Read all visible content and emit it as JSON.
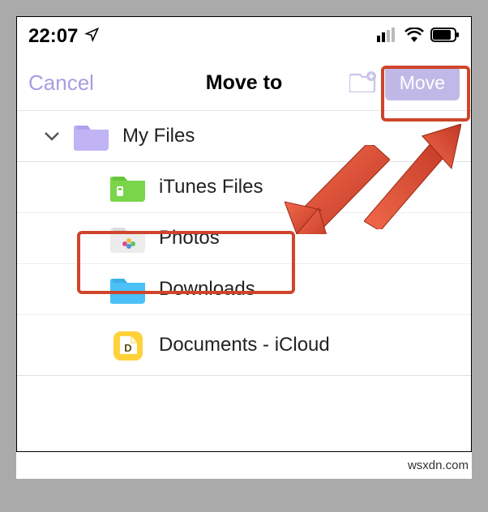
{
  "status": {
    "time": "22:07"
  },
  "nav": {
    "cancel_label": "Cancel",
    "title": "Move to",
    "move_label": "Move"
  },
  "folders": {
    "root": {
      "label": "My Files"
    },
    "itunes": {
      "label": "iTunes Files"
    },
    "photos": {
      "label": "Photos"
    },
    "downloads": {
      "label": "Downloads"
    },
    "icloud": {
      "label": "Documents - iCloud"
    }
  },
  "attribution": "wsxdn.com"
}
